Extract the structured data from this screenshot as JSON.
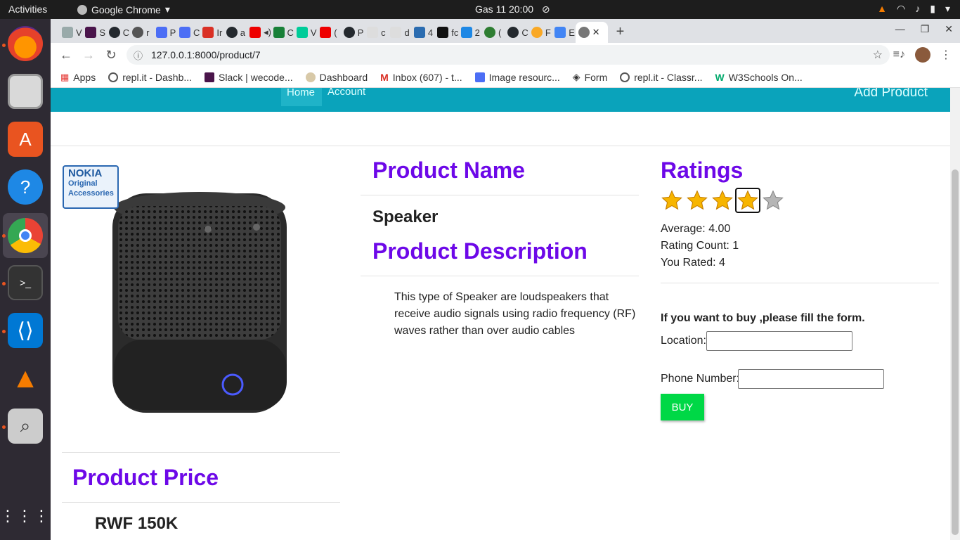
{
  "topbar": {
    "activities": "Activities",
    "app_name": "Google Chrome",
    "clock": "Gas 11  20:00"
  },
  "tabs": [
    {
      "label": "V",
      "color": "#9aa"
    },
    {
      "label": "S",
      "color": "#4a154b"
    },
    {
      "label": "C",
      "color": "#24292e"
    },
    {
      "label": "r",
      "color": "#555"
    },
    {
      "label": "P",
      "color": "#4c6ef5"
    },
    {
      "label": "C",
      "color": "#4c6ef5"
    },
    {
      "label": "Ir",
      "color": "#d93025"
    },
    {
      "label": "a",
      "color": "#24292e"
    },
    {
      "label": "",
      "color": "#e00"
    },
    {
      "label": "C",
      "color": "#188038"
    },
    {
      "label": "V",
      "color": "#0c9"
    },
    {
      "label": "(",
      "color": "#e00"
    },
    {
      "label": "P",
      "color": "#24292e"
    },
    {
      "label": "c",
      "color": "#ddd"
    },
    {
      "label": "d",
      "color": "#ddd"
    },
    {
      "label": "4",
      "color": "#2b6cb0"
    },
    {
      "label": "fc",
      "color": "#111"
    },
    {
      "label": "2",
      "color": "#1e88e5"
    },
    {
      "label": "(",
      "color": "#2e7d32"
    },
    {
      "label": "C",
      "color": "#24292e"
    },
    {
      "label": "F",
      "color": "#f9a825"
    },
    {
      "label": "E",
      "color": "#4285f4"
    }
  ],
  "url": "127.0.0.1:8000/product/7",
  "bookmarks": [
    {
      "label": "Apps",
      "color": "#e53935"
    },
    {
      "label": "repl.it - Dashb...",
      "color": "#555"
    },
    {
      "label": "Slack | wecode...",
      "color": "#4a154b"
    },
    {
      "label": "Dashboard",
      "color": "#9aa"
    },
    {
      "label": "Inbox (607) - t...",
      "color": "#d93025"
    },
    {
      "label": "Image resourc...",
      "color": "#4c6ef5"
    },
    {
      "label": "Form",
      "color": "#333"
    },
    {
      "label": "repl.it - Classr...",
      "color": "#555"
    },
    {
      "label": "W3Schools On...",
      "color": "#04aa6d"
    }
  ],
  "nav": {
    "home": "Home",
    "account": "Account",
    "add_product": "Add Product"
  },
  "product": {
    "badge_brand": "NOKIA",
    "badge_line1": "Original",
    "badge_line2": "Accessories",
    "name_heading": "Product Name",
    "name": "Speaker",
    "description_heading": "Product Description",
    "description": "This type of Speaker are loudspeakers that receive audio signals using radio frequency (RF) waves rather than over audio cables",
    "price_heading": "Product Price",
    "price": "RWF 150K"
  },
  "ratings": {
    "heading": "Ratings",
    "stars_filled": 4,
    "stars_total": 5,
    "average": "Average: 4.00",
    "count": "Rating Count: 1",
    "you_rated": "You Rated: 4"
  },
  "form": {
    "prompt": "If you want to buy ,please fill the form.",
    "location_label": "Location:",
    "location_value": "",
    "phone_label": "Phone Number:",
    "phone_value": "",
    "buy_label": "BUY"
  },
  "colors": {
    "heading": "#6d08e8",
    "navbar": "#0aa3bb",
    "buy_button": "#00d846"
  }
}
